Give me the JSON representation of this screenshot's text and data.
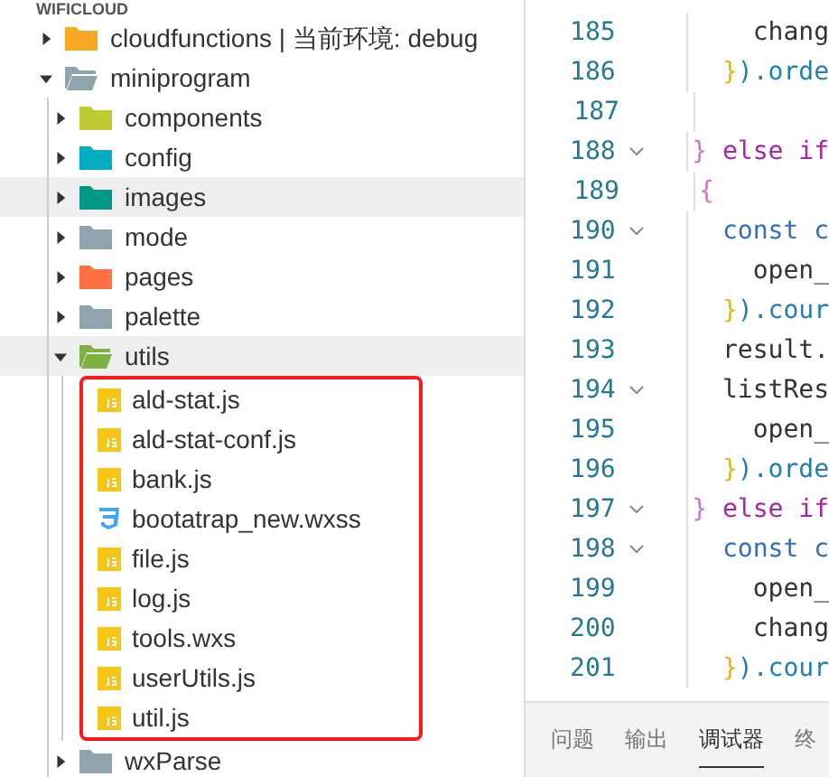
{
  "explorer": {
    "title": "WIFICLOUD",
    "tree": [
      {
        "name": "cloudfunctions | 当前环境: debug",
        "kind": "folder",
        "color": "#f9a825",
        "expanded": false,
        "highlighted": false
      },
      {
        "name": "miniprogram",
        "kind": "folder",
        "color": "#90a4ae",
        "expanded": true,
        "highlighted": false,
        "children": [
          {
            "name": "components",
            "kind": "folder",
            "color": "#c0ca33",
            "expanded": false,
            "highlighted": false
          },
          {
            "name": "config",
            "kind": "folder",
            "color": "#00acc1",
            "expanded": false,
            "highlighted": false
          },
          {
            "name": "images",
            "kind": "folder",
            "color": "#009688",
            "expanded": false,
            "highlighted": true
          },
          {
            "name": "mode",
            "kind": "folder",
            "color": "#90a4ae",
            "expanded": false,
            "highlighted": false
          },
          {
            "name": "pages",
            "kind": "folder",
            "color": "#ff7043",
            "expanded": false,
            "highlighted": false
          },
          {
            "name": "palette",
            "kind": "folder",
            "color": "#90a4ae",
            "expanded": false,
            "highlighted": false
          },
          {
            "name": "utils",
            "kind": "folder",
            "color": "#7cb342",
            "expanded": true,
            "highlighted": true,
            "boxed": true,
            "children": [
              {
                "name": "ald-stat.js",
                "kind": "js",
                "highlighted": false
              },
              {
                "name": "ald-stat-conf.js",
                "kind": "js",
                "highlighted": false
              },
              {
                "name": "bank.js",
                "kind": "js",
                "highlighted": false
              },
              {
                "name": "bootatrap_new.wxss",
                "kind": "css",
                "highlighted": false
              },
              {
                "name": "file.js",
                "kind": "js",
                "highlighted": false
              },
              {
                "name": "log.js",
                "kind": "js",
                "highlighted": false
              },
              {
                "name": "tools.wxs",
                "kind": "js",
                "highlighted": false
              },
              {
                "name": "userUtils.js",
                "kind": "js",
                "highlighted": false
              },
              {
                "name": "util.js",
                "kind": "js",
                "highlighted": false
              }
            ]
          },
          {
            "name": "wxParse",
            "kind": "folder",
            "color": "#90a4ae",
            "expanded": false,
            "highlighted": false
          }
        ]
      }
    ]
  },
  "editor": {
    "lines": [
      {
        "number": "185",
        "foldable": false,
        "tokens": [
          {
            "text": "    chang",
            "kind": "plain"
          }
        ]
      },
      {
        "number": "186",
        "foldable": false,
        "tokens": [
          {
            "text": "  }",
            "kind": "brace"
          },
          {
            "text": ").orde",
            "kind": "method"
          }
        ]
      },
      {
        "number": "187",
        "foldable": false
      },
      {
        "number": "188",
        "foldable": true,
        "tokens": [
          {
            "text": "}",
            "kind": "brace2"
          },
          {
            "text": " else if",
            "kind": "keyword"
          }
        ]
      },
      {
        "number": "189",
        "foldable": false,
        "tokens": [
          {
            "text": "{",
            "kind": "brace2"
          }
        ]
      },
      {
        "number": "190",
        "foldable": true,
        "tokens": [
          {
            "text": "  const c",
            "kind": "decl"
          }
        ]
      },
      {
        "number": "191",
        "foldable": false,
        "tokens": [
          {
            "text": "    open_",
            "kind": "plain"
          }
        ]
      },
      {
        "number": "192",
        "foldable": false,
        "tokens": [
          {
            "text": "  }",
            "kind": "brace"
          },
          {
            "text": ").cour",
            "kind": "method"
          }
        ]
      },
      {
        "number": "193",
        "foldable": false,
        "tokens": [
          {
            "text": "  result.",
            "kind": "plain"
          }
        ]
      },
      {
        "number": "194",
        "foldable": true,
        "tokens": [
          {
            "text": "  listRes",
            "kind": "plain"
          }
        ]
      },
      {
        "number": "195",
        "foldable": false,
        "tokens": [
          {
            "text": "    open_",
            "kind": "plain"
          }
        ]
      },
      {
        "number": "196",
        "foldable": false,
        "tokens": [
          {
            "text": "  }",
            "kind": "brace"
          },
          {
            "text": ").orde",
            "kind": "method"
          }
        ]
      },
      {
        "number": "197",
        "foldable": true,
        "tokens": [
          {
            "text": "}",
            "kind": "brace2"
          },
          {
            "text": " else if",
            "kind": "keyword"
          }
        ]
      },
      {
        "number": "198",
        "foldable": true,
        "tokens": [
          {
            "text": "  const c",
            "kind": "decl"
          }
        ]
      },
      {
        "number": "199",
        "foldable": false,
        "tokens": [
          {
            "text": "    open_",
            "kind": "plain"
          }
        ]
      },
      {
        "number": "200",
        "foldable": false,
        "tokens": [
          {
            "text": "    chang",
            "kind": "plain"
          }
        ]
      },
      {
        "number": "201",
        "foldable": false,
        "tokens": [
          {
            "text": "  }",
            "kind": "brace"
          },
          {
            "text": ").cour",
            "kind": "method"
          }
        ]
      }
    ]
  },
  "panel_tabs": [
    {
      "label": "问题",
      "selected": false
    },
    {
      "label": "输出",
      "selected": false
    },
    {
      "label": "调试器",
      "selected": true
    },
    {
      "label": "终",
      "selected": false
    }
  ]
}
